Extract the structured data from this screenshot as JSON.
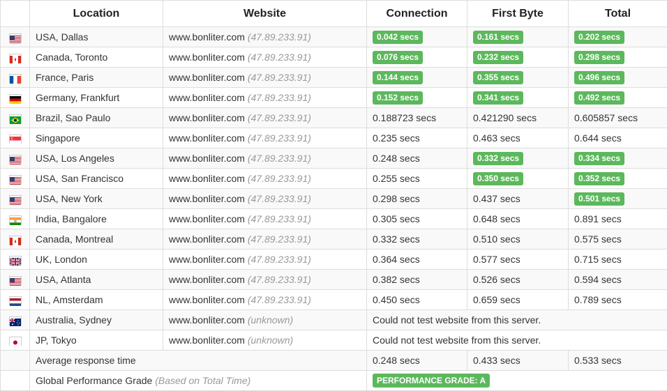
{
  "headers": {
    "location": "Location",
    "website": "Website",
    "connection": "Connection",
    "first_byte": "First Byte",
    "total": "Total"
  },
  "rows": [
    {
      "flag": "us",
      "location": "USA, Dallas",
      "site": "www.bonliter.com",
      "ip": "(47.89.233.91)",
      "connection": "0.042 secs",
      "first_byte": "0.161 secs",
      "total": "0.202 secs",
      "hl": [
        true,
        true,
        true
      ]
    },
    {
      "flag": "ca",
      "location": "Canada, Toronto",
      "site": "www.bonliter.com",
      "ip": "(47.89.233.91)",
      "connection": "0.076 secs",
      "first_byte": "0.232 secs",
      "total": "0.298 secs",
      "hl": [
        true,
        true,
        true
      ]
    },
    {
      "flag": "fr",
      "location": "France, Paris",
      "site": "www.bonliter.com",
      "ip": "(47.89.233.91)",
      "connection": "0.144 secs",
      "first_byte": "0.355 secs",
      "total": "0.496 secs",
      "hl": [
        true,
        true,
        true
      ]
    },
    {
      "flag": "de",
      "location": "Germany, Frankfurt",
      "site": "www.bonliter.com",
      "ip": "(47.89.233.91)",
      "connection": "0.152 secs",
      "first_byte": "0.341 secs",
      "total": "0.492 secs",
      "hl": [
        true,
        true,
        true
      ]
    },
    {
      "flag": "br",
      "location": "Brazil, Sao Paulo",
      "site": "www.bonliter.com",
      "ip": "(47.89.233.91)",
      "connection": "0.188723 secs",
      "first_byte": "0.421290 secs",
      "total": "0.605857 secs",
      "hl": [
        false,
        false,
        false
      ]
    },
    {
      "flag": "sg",
      "location": "Singapore",
      "site": "www.bonliter.com",
      "ip": "(47.89.233.91)",
      "connection": "0.235 secs",
      "first_byte": "0.463 secs",
      "total": "0.644 secs",
      "hl": [
        false,
        false,
        false
      ]
    },
    {
      "flag": "us",
      "location": "USA, Los Angeles",
      "site": "www.bonliter.com",
      "ip": "(47.89.233.91)",
      "connection": "0.248 secs",
      "first_byte": "0.332 secs",
      "total": "0.334 secs",
      "hl": [
        false,
        true,
        true
      ]
    },
    {
      "flag": "us",
      "location": "USA, San Francisco",
      "site": "www.bonliter.com",
      "ip": "(47.89.233.91)",
      "connection": "0.255 secs",
      "first_byte": "0.350 secs",
      "total": "0.352 secs",
      "hl": [
        false,
        true,
        true
      ]
    },
    {
      "flag": "us",
      "location": "USA, New York",
      "site": "www.bonliter.com",
      "ip": "(47.89.233.91)",
      "connection": "0.298 secs",
      "first_byte": "0.437 secs",
      "total": "0.501 secs",
      "hl": [
        false,
        false,
        true
      ]
    },
    {
      "flag": "in",
      "location": "India, Bangalore",
      "site": "www.bonliter.com",
      "ip": "(47.89.233.91)",
      "connection": "0.305 secs",
      "first_byte": "0.648 secs",
      "total": "0.891 secs",
      "hl": [
        false,
        false,
        false
      ]
    },
    {
      "flag": "ca",
      "location": "Canada, Montreal",
      "site": "www.bonliter.com",
      "ip": "(47.89.233.91)",
      "connection": "0.332 secs",
      "first_byte": "0.510 secs",
      "total": "0.575 secs",
      "hl": [
        false,
        false,
        false
      ]
    },
    {
      "flag": "gb",
      "location": "UK, London",
      "site": "www.bonliter.com",
      "ip": "(47.89.233.91)",
      "connection": "0.364 secs",
      "first_byte": "0.577 secs",
      "total": "0.715 secs",
      "hl": [
        false,
        false,
        false
      ]
    },
    {
      "flag": "us",
      "location": "USA, Atlanta",
      "site": "www.bonliter.com",
      "ip": "(47.89.233.91)",
      "connection": "0.382 secs",
      "first_byte": "0.526 secs",
      "total": "0.594 secs",
      "hl": [
        false,
        false,
        false
      ]
    },
    {
      "flag": "nl",
      "location": "NL, Amsterdam",
      "site": "www.bonliter.com",
      "ip": "(47.89.233.91)",
      "connection": "0.450 secs",
      "first_byte": "0.659 secs",
      "total": "0.789 secs",
      "hl": [
        false,
        false,
        false
      ]
    },
    {
      "flag": "au",
      "location": "Australia, Sydney",
      "site": "www.bonliter.com",
      "ip": "(unknown)",
      "error": "Could not test website from this server."
    },
    {
      "flag": "jp",
      "location": "JP, Tokyo",
      "site": "www.bonliter.com",
      "ip": "(unknown)",
      "error": "Could not test website from this server."
    }
  ],
  "average": {
    "label": "Average response time",
    "connection": "0.248 secs",
    "first_byte": "0.433 secs",
    "total": "0.533 secs"
  },
  "grade": {
    "label": "Global Performance Grade",
    "note": "(Based on Total Time)",
    "badge": "PERFORMANCE GRADE: A"
  },
  "colors": {
    "badge_green": "#5cb85c",
    "row_stripe": "#f9f9f9",
    "border": "#dddddd"
  }
}
